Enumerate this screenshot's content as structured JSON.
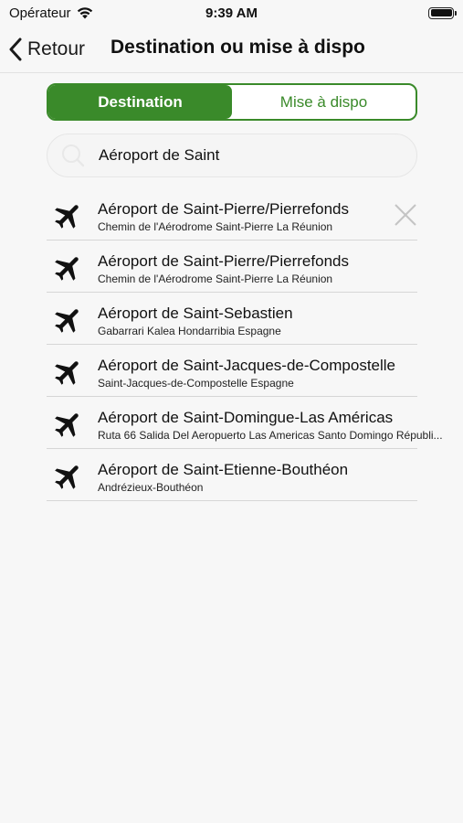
{
  "status_bar": {
    "carrier": "Opérateur",
    "time": "9:39 AM",
    "icons": [
      "wifi-icon",
      "battery-icon"
    ]
  },
  "nav": {
    "back_label": "Retour",
    "back_icon": "chevron-left-icon",
    "title": "Destination ou mise à dispo"
  },
  "segmented": {
    "options": [
      "Destination",
      "Mise à dispo"
    ],
    "selected": "Destination",
    "accent_color": "#3a8a2a"
  },
  "search": {
    "value": "Aéroport de Saint",
    "icon": "search-icon"
  },
  "results": [
    {
      "name": "Aéroport de Saint-Pierre/Pierrefonds",
      "address": "Chemin de l'Aérodrome Saint-Pierre La Réunion",
      "icon": "airplane-icon",
      "clear_icon": "close-icon"
    },
    {
      "name": "Aéroport de Saint-Pierre/Pierrefonds",
      "address": "Chemin de l'Aérodrome Saint-Pierre La Réunion",
      "icon": "airplane-icon"
    },
    {
      "name": "Aéroport de Saint-Sebastien",
      "address": "Gabarrari Kalea Hondarribia Espagne",
      "icon": "airplane-icon"
    },
    {
      "name": "Aéroport de Saint-Jacques-de-Compostelle",
      "address": "Saint-Jacques-de-Compostelle Espagne",
      "icon": "airplane-icon"
    },
    {
      "name": "Aéroport de Saint-Domingue-Las Américas",
      "address": "Ruta 66 Salida Del Aeropuerto Las Americas Santo Domingo Républi...",
      "icon": "airplane-icon"
    },
    {
      "name": "Aéroport de Saint-Etienne-Bouthéon",
      "address": "Andrézieux-Bouthéon",
      "icon": "airplane-icon"
    }
  ]
}
